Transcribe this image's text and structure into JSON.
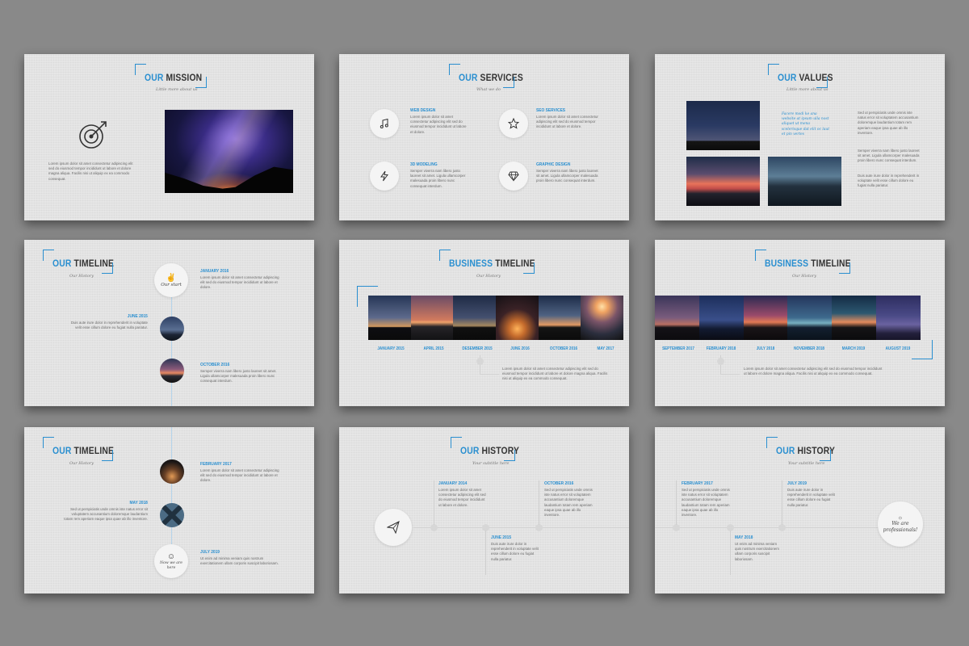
{
  "colors": {
    "accent": "#2a8fd0",
    "background": "#898989",
    "slide": "#e6e6e6"
  },
  "lorem": {
    "l1": "Lorem ipsum dolor sit amet consectetur adipiscing elit sed do eiusmod tempor incididunt ut labore et dolore magna aliqua. Facilis nisi ut aliquip ex ea commodo consequat.",
    "l2": "Lorem ipsum dolor sit amet consectetur adipiscing elit sed do eiusmod tempor incididunt ut labore et dolore.",
    "l3": "Duis aute irure dolor in reprehenderit in voluptate velit esse cillum dolore eu fugiat nulla pariatur.",
    "l4": "Sed ut perspiciatis unde omnis iste natus error sit voluptatem accusantium doloremque laudantium totam rem aperiam eaque ipsa quae ab illo inventore.",
    "l5": "Semper viverra nam libero justo laoreet sit amet. Ligula ullamcorper malesuada proin libero nunc consequat interdum.",
    "l6": "Ut enim ad minima veniam quis nostrum exercitationem ullam corporis suscipit laboriosam."
  },
  "s1": {
    "title_acc": "OUR",
    "title_rest": "MISSION",
    "subtitle": "Little more about us",
    "icon": "target-icon",
    "text": "Lorem ipsum dolor sit amet consectetur adipiscing elit sed do eiusmod tempor incididunt ut labore et dolore magna aliqua. Facilis nisi ut aliquip ex ea commodo consequat."
  },
  "s2": {
    "title_acc": "OUR",
    "title_rest": "SERVICES",
    "subtitle": "What we do",
    "services": [
      {
        "label": "WEB DESIGN",
        "icon": "music-note-icon"
      },
      {
        "label": "SEO SERVICES",
        "icon": "star-icon"
      },
      {
        "label": "3D MODELING",
        "icon": "lightning-icon"
      },
      {
        "label": "GRAPHIC DESIGN",
        "icon": "diamond-icon"
      }
    ]
  },
  "s3": {
    "title_acc": "OUR",
    "title_rest": "VALUES",
    "subtitle": "Little more about us",
    "quote": "Facere modi ke ana website at ipsum ulla nost aliquet ut mena scelerisque dat elit oc laut et pin vertes"
  },
  "s4": {
    "title_acc": "OUR",
    "title_rest": "TIMELINE",
    "subtitle": "Our History",
    "badge": "Our start",
    "items": [
      {
        "date": "JANUARY 2016"
      },
      {
        "date": "JUNE 2015"
      },
      {
        "date": "OCTOBER 2016"
      }
    ]
  },
  "s5": {
    "title_acc": "BUSINESS",
    "title_rest": "TIMELINE",
    "subtitle": "Our History",
    "dates": [
      "JANUARY 2015",
      "APRIL 2015",
      "DESEMBER 2015",
      "JUNE 2016",
      "OCTOBER 2016",
      "MAY 2017"
    ]
  },
  "s6": {
    "title_acc": "BUSINESS",
    "title_rest": "TIMELINE",
    "subtitle": "Our History",
    "dates": [
      "SEPTEMBER 2017",
      "FEBRUARY 2018",
      "JULY 2018",
      "NOVEMBER 2018",
      "MARCH 2019",
      "AUGUST 2019"
    ]
  },
  "s7": {
    "title_acc": "OUR",
    "title_rest": "TIMELINE",
    "subtitle": "Our History",
    "badge": "Now we are here",
    "items": [
      {
        "date": "FEBRUARY 2017"
      },
      {
        "date": "MAY 2018"
      },
      {
        "date": "JULY 2019"
      }
    ]
  },
  "s8": {
    "title_acc": "OUR",
    "title_rest": "HISTORY",
    "subtitle": "Your subtitle here",
    "items": [
      {
        "date": "JANUARY 2014"
      },
      {
        "date": "OCTOBER 2016"
      },
      {
        "date": "JUNE 2015"
      }
    ]
  },
  "s9": {
    "title_acc": "OUR",
    "title_rest": "HISTORY",
    "subtitle": "Your subtitle here",
    "badge": "We are professionals!",
    "items": [
      {
        "date": "FEBRUARY 2017"
      },
      {
        "date": "JULY 2019"
      },
      {
        "date": "MAY 2018"
      }
    ]
  }
}
